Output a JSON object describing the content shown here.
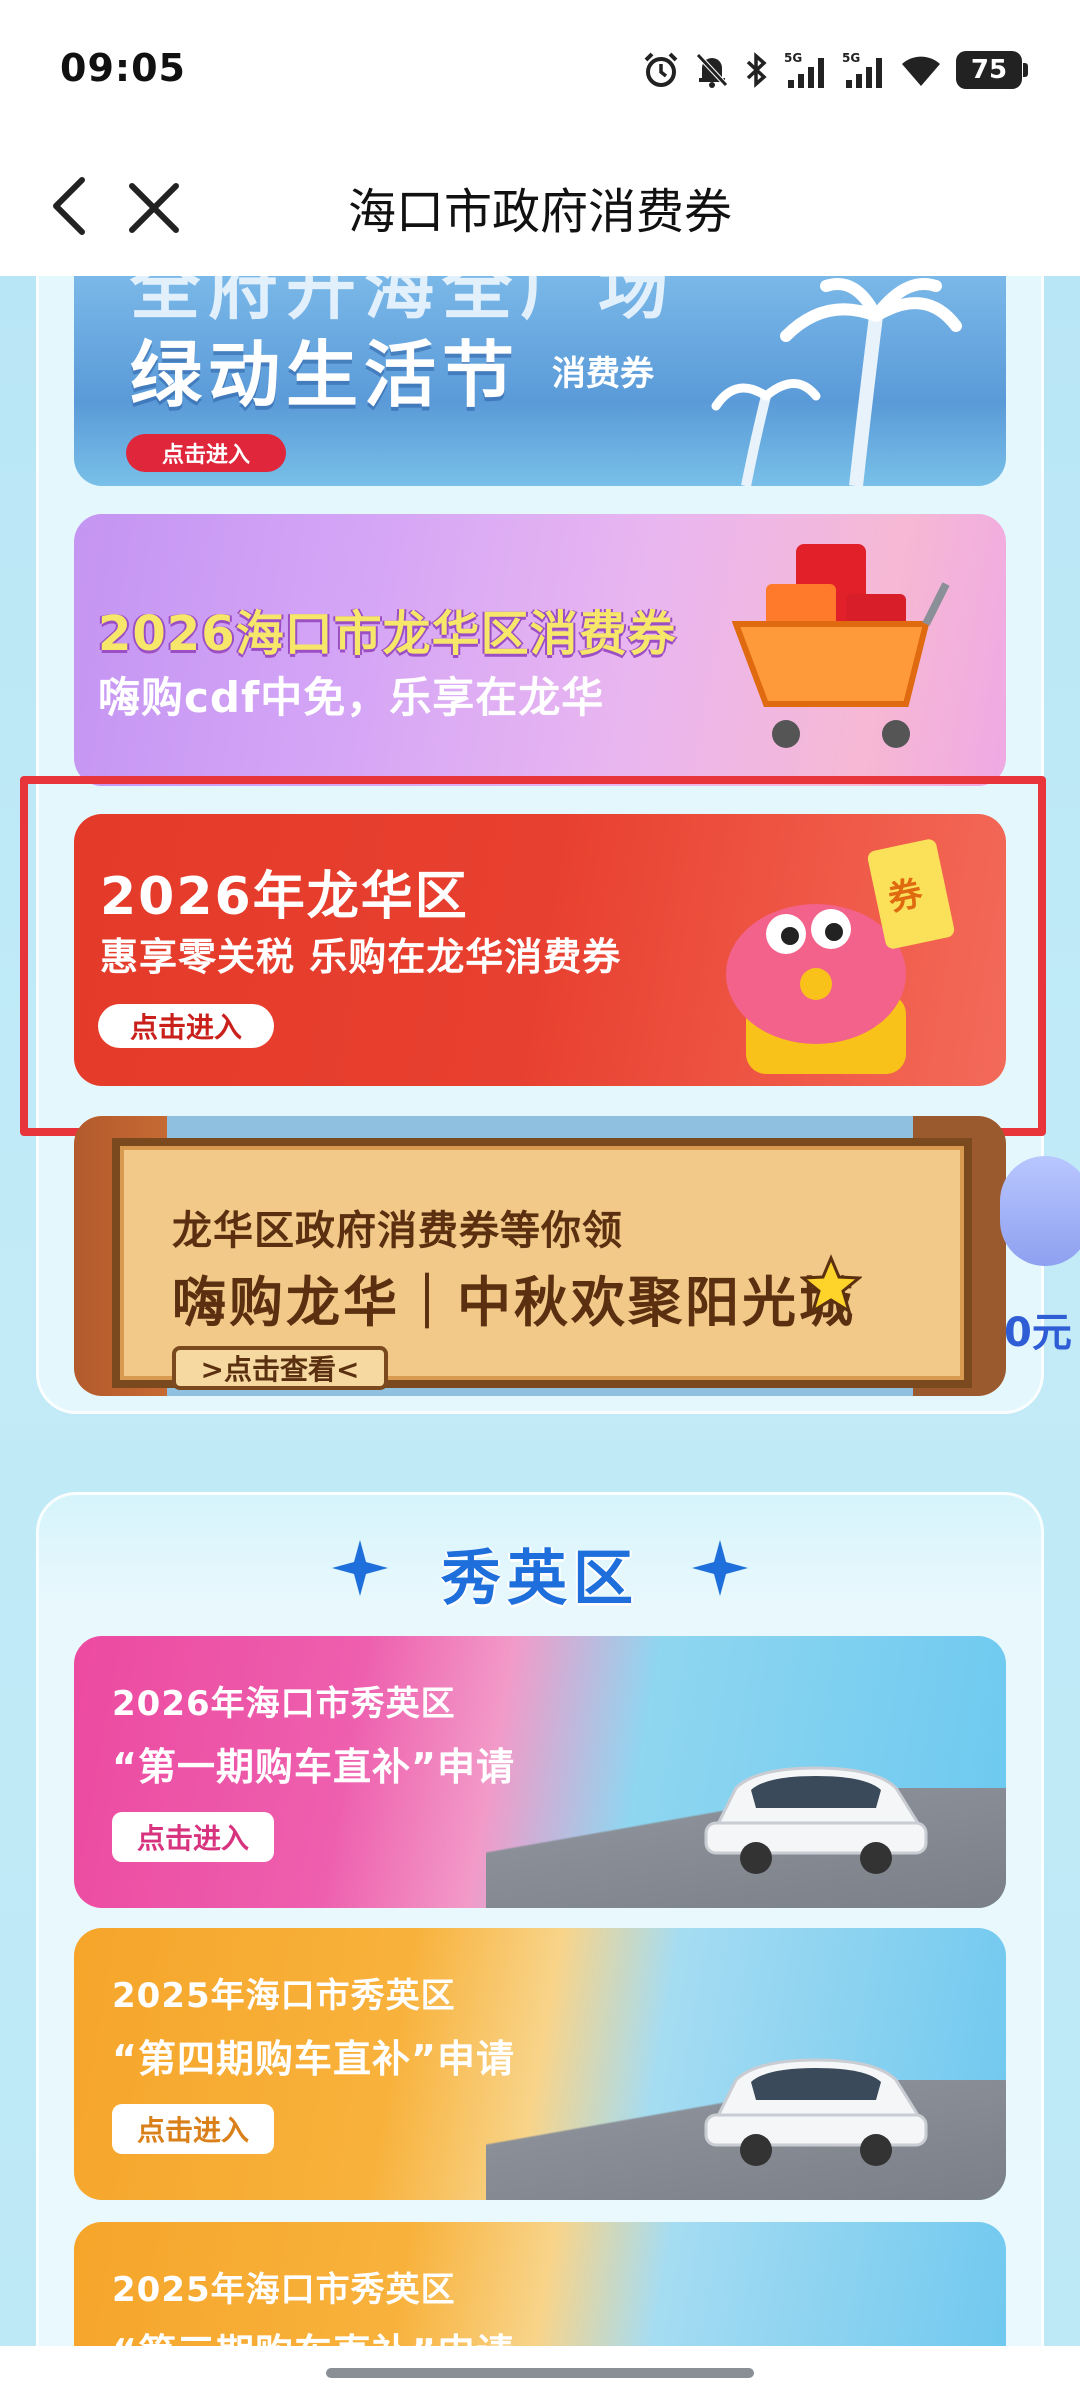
{
  "status": {
    "time": "09:05",
    "battery": "75"
  },
  "nav": {
    "title": "海口市政府消费券"
  },
  "banners": [
    {
      "title_top": "全府开海全广场",
      "title": "绿动生活节",
      "subtitle": "消费券",
      "button": "点击进入"
    },
    {
      "title": "2026海口市龙华区消费券",
      "subtitle": "嗨购cdf中免，乐享在龙华"
    },
    {
      "title": "2026年龙华区",
      "subtitle": "惠享零关税  乐购在龙华消费券",
      "button": "点击进入",
      "tag": "券"
    },
    {
      "line1": "龙华区政府消费券等你领",
      "line2": "嗨购龙华｜中秋欢聚阳光城",
      "button": ">点击查看<",
      "side_text": "0元"
    }
  ],
  "section": {
    "title": "秀英区"
  },
  "car_banners": [
    {
      "line1": "2026年海口市秀英区",
      "line2": "“第一期购车直补”申请",
      "button": "点击进入"
    },
    {
      "line1": "2025年海口市秀英区",
      "line2": "“第四期购车直补”申请",
      "button": "点击进入"
    },
    {
      "line1": "2025年海口市秀英区",
      "line2": "“第三期购车直补”申请"
    }
  ],
  "colors": {
    "highlight": "#e8353b",
    "section_title": "#1e6fdc"
  }
}
